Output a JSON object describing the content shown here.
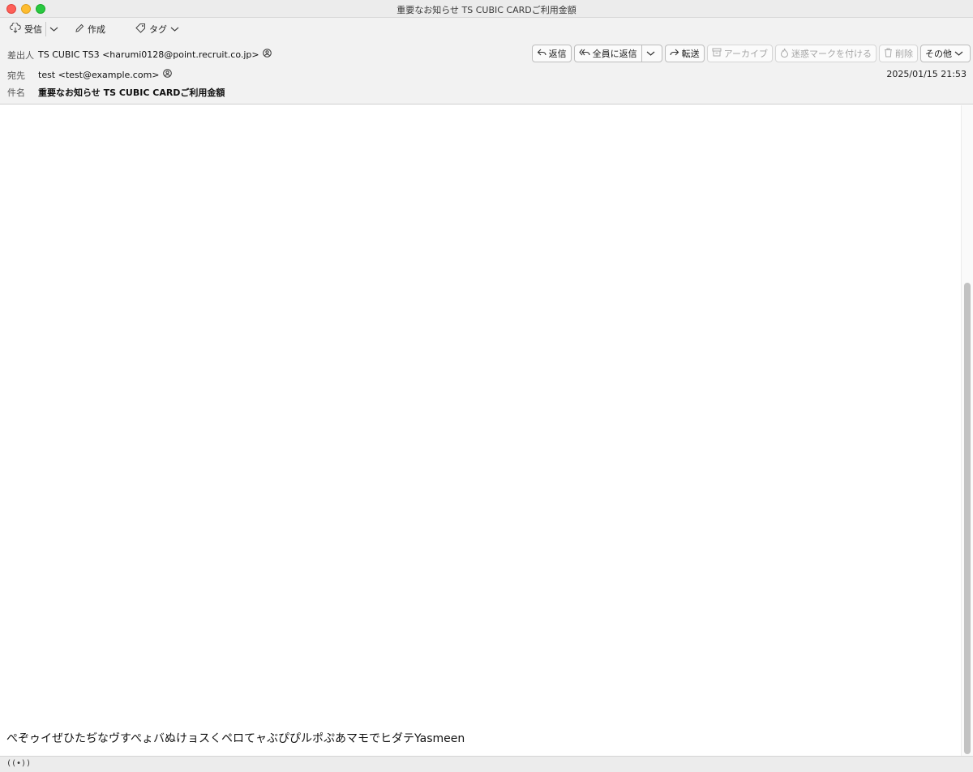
{
  "window": {
    "title": "重要なお知らせ TS CUBIC CARDご利用金額"
  },
  "toolbar": {
    "receive_label": "受信",
    "compose_label": "作成",
    "tag_label": "タグ"
  },
  "header": {
    "from_label": "差出人",
    "from_value": "TS CUBIC TS3 <harumi0128@point.recruit.co.jp>",
    "to_label": "宛先",
    "to_value": "test <test@example.com>",
    "subject_label": "件名",
    "subject_value": "重要なお知らせ TS CUBIC CARDご利用金額",
    "date": "2025/01/15 21:53"
  },
  "actions": {
    "reply": "返信",
    "reply_all": "全員に返信",
    "forward": "転送",
    "archive": "アーカイブ",
    "junk": "迷惑マークを付ける",
    "delete": "削除",
    "more": "その他"
  },
  "message": {
    "body_text": "ぺぞゥイぜひたぢなヴすぺょバぬけョスくペロてャぶぴぴルポぷあマモでヒダテYasmeen"
  },
  "statusbar": {
    "icon_text": "((•))"
  }
}
